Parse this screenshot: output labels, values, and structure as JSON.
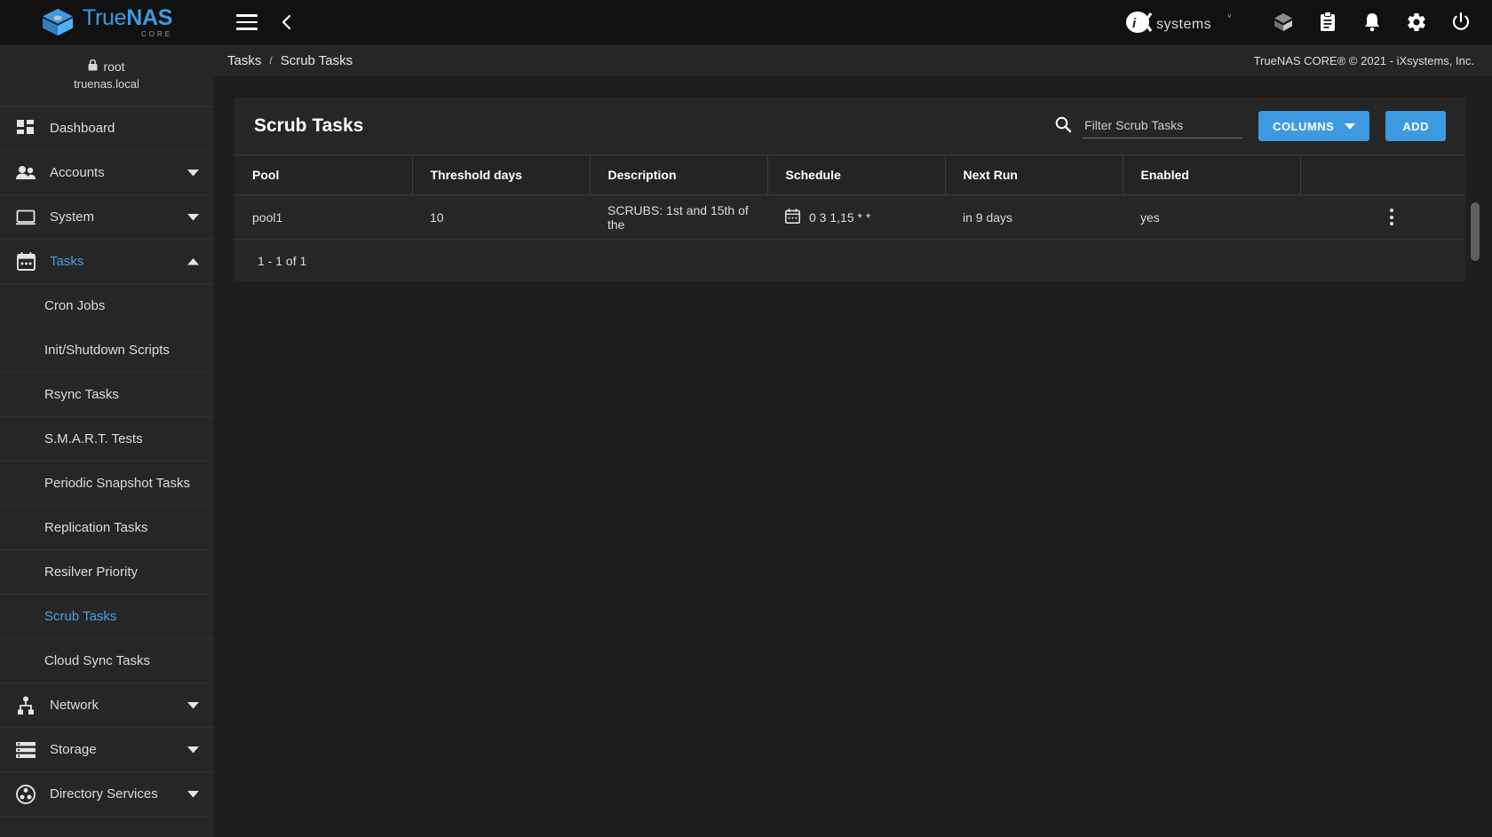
{
  "brand": {
    "name_part1": "True",
    "name_part2": "NAS",
    "edition": "CORE",
    "logo_icon": "truenas-cube-logo",
    "accent": "#3d9ae0"
  },
  "topbar": {
    "menu_icon": "hamburger-menu-icon",
    "back_icon": "chevron-left-icon",
    "vendor_logo": "ixsystems-logo",
    "vendor_name": "iXsystems",
    "icons": [
      {
        "name": "jails-cube-icon",
        "glyph": "cube"
      },
      {
        "name": "task-manager-clipboard-icon",
        "glyph": "clipboard"
      },
      {
        "name": "notifications-bell-icon",
        "glyph": "bell"
      },
      {
        "name": "settings-gear-icon",
        "glyph": "gear"
      },
      {
        "name": "power-icon",
        "glyph": "power"
      }
    ]
  },
  "breadcrumb": {
    "parent": "Tasks",
    "separator": "/",
    "current": "Scrub Tasks",
    "copyright": "TrueNAS CORE® © 2021 - iXsystems, Inc."
  },
  "sidebar": {
    "user": {
      "lock_icon": "lock-icon",
      "username": "root",
      "hostname": "truenas.local"
    },
    "items": [
      {
        "label": "Dashboard",
        "icon": "dashboard-grid-icon",
        "type": "top",
        "caret": "none",
        "active": false
      },
      {
        "label": "Accounts",
        "icon": "accounts-people-icon",
        "type": "top",
        "caret": "down",
        "active": false
      },
      {
        "label": "System",
        "icon": "system-monitor-icon",
        "type": "top",
        "caret": "down",
        "active": false
      },
      {
        "label": "Tasks",
        "icon": "tasks-calendar-icon",
        "type": "top",
        "caret": "up",
        "active": true
      },
      {
        "label": "Cron Jobs",
        "icon": "",
        "type": "sub",
        "caret": "none",
        "active": false
      },
      {
        "label": "Init/Shutdown Scripts",
        "icon": "",
        "type": "sub",
        "caret": "none",
        "active": false
      },
      {
        "label": "Rsync Tasks",
        "icon": "",
        "type": "sub",
        "caret": "none",
        "active": false
      },
      {
        "label": "S.M.A.R.T. Tests",
        "icon": "",
        "type": "sub",
        "caret": "none",
        "active": false
      },
      {
        "label": "Periodic Snapshot Tasks",
        "icon": "",
        "type": "sub",
        "caret": "none",
        "active": false
      },
      {
        "label": "Replication Tasks",
        "icon": "",
        "type": "sub",
        "caret": "none",
        "active": false
      },
      {
        "label": "Resilver Priority",
        "icon": "",
        "type": "sub",
        "caret": "none",
        "active": false
      },
      {
        "label": "Scrub Tasks",
        "icon": "",
        "type": "sub",
        "caret": "none",
        "active": true
      },
      {
        "label": "Cloud Sync Tasks",
        "icon": "",
        "type": "sub",
        "caret": "none",
        "active": false
      },
      {
        "label": "Network",
        "icon": "network-nodes-icon",
        "type": "top",
        "caret": "down",
        "active": false
      },
      {
        "label": "Storage",
        "icon": "storage-stack-icon",
        "type": "top",
        "caret": "down",
        "active": false
      },
      {
        "label": "Directory Services",
        "icon": "directory-services-icon",
        "type": "top",
        "caret": "down",
        "active": false
      }
    ]
  },
  "main": {
    "card_title": "Scrub Tasks",
    "search": {
      "icon": "search-icon",
      "placeholder": "Filter Scrub Tasks",
      "value": ""
    },
    "columns_button": {
      "label": "COLUMNS",
      "caret_icon": "chevron-down-icon"
    },
    "add_button": {
      "label": "ADD"
    },
    "table": {
      "headers": [
        "Pool",
        "Threshold days",
        "Description",
        "Schedule",
        "Next Run",
        "Enabled",
        ""
      ],
      "rows": [
        {
          "pool": "pool1",
          "threshold_days": "10",
          "description": "SCRUBS: 1st and 15th of the",
          "schedule_icon": "calendar-icon",
          "schedule": "0 3 1,15 * *",
          "next_run": "in 9 days",
          "enabled": "yes",
          "row_menu_icon": "more-vertical-icon"
        }
      ]
    },
    "pagination": "1 - 1 of 1",
    "scrollbar": "vertical-scrollbar"
  }
}
